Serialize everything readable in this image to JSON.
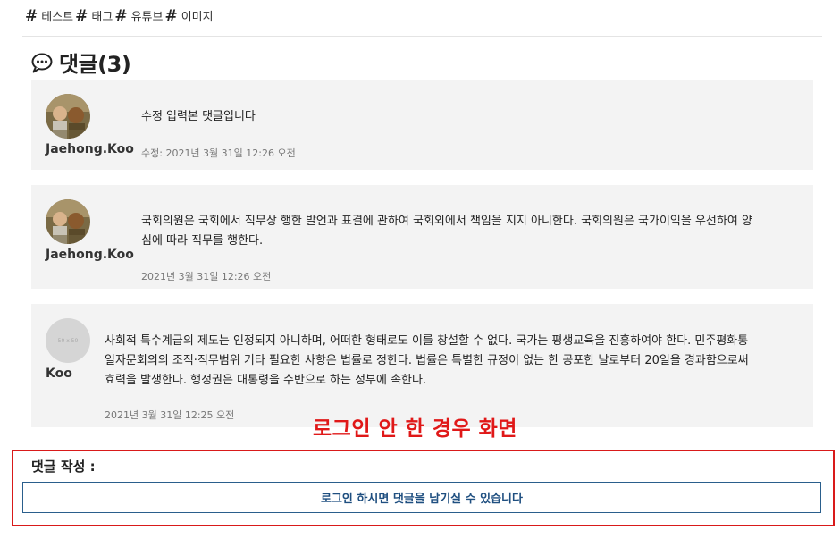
{
  "tags": [
    {
      "hash": "#",
      "name": "테스트"
    },
    {
      "hash": "#",
      "name": "태그"
    },
    {
      "hash": "#",
      "name": "유튜브"
    },
    {
      "hash": "#",
      "name": "이미지"
    }
  ],
  "comments_section": {
    "title": "댓글(3)",
    "icon": "speech-bubble-icon"
  },
  "comments": [
    {
      "author": "Jaehong.Koo",
      "avatar": "photo",
      "text": "수정 입력본 댓글입니다",
      "meta": "수정: 2021년 3월 31일 12:26 오전"
    },
    {
      "author": "Jaehong.Koo",
      "avatar": "photo",
      "text_line1": "국회의원은 국회에서 직무상 행한 발언과 표결에 관하여 국회외에서 책임을 지지 아니한다. 국회의원은 국가이익을 우선하여 양",
      "text_line2": "심에 따라 직무를 행한다.",
      "meta": "2021년 3월 31일 12:26 오전"
    },
    {
      "author": "Koo",
      "avatar": "placeholder",
      "avatar_text": "50 x 50",
      "text_line1": "사회적 특수계급의 제도는 인정되지 아니하며, 어떠한 형태로도 이를 창설할 수 없다. 국가는 평생교육을 진흥하여야 한다. 민주평화통",
      "text_line2": "일자문회의의 조직·직무범위 기타 필요한 사항은 법률로 정한다. 법률은 특별한 규정이 없는 한 공포한 날로부터 20일을 경과함으로써",
      "text_line3": "효력을 발생한다. 행정권은 대통령을 수반으로 하는 정부에 속한다.",
      "meta": "2021년 3월 31일 12:25 오전"
    }
  ],
  "annotation": "로그인 안 한 경우 화면",
  "write": {
    "label": "댓글 작성 :",
    "login_button": "로그인 하시면 댓글을 남기실 수 있습니다"
  },
  "colors": {
    "card_bg": "#f3f3f3",
    "annotation_red": "#e01818",
    "button_border": "#2a5e8c",
    "button_text": "#1f4f80"
  }
}
